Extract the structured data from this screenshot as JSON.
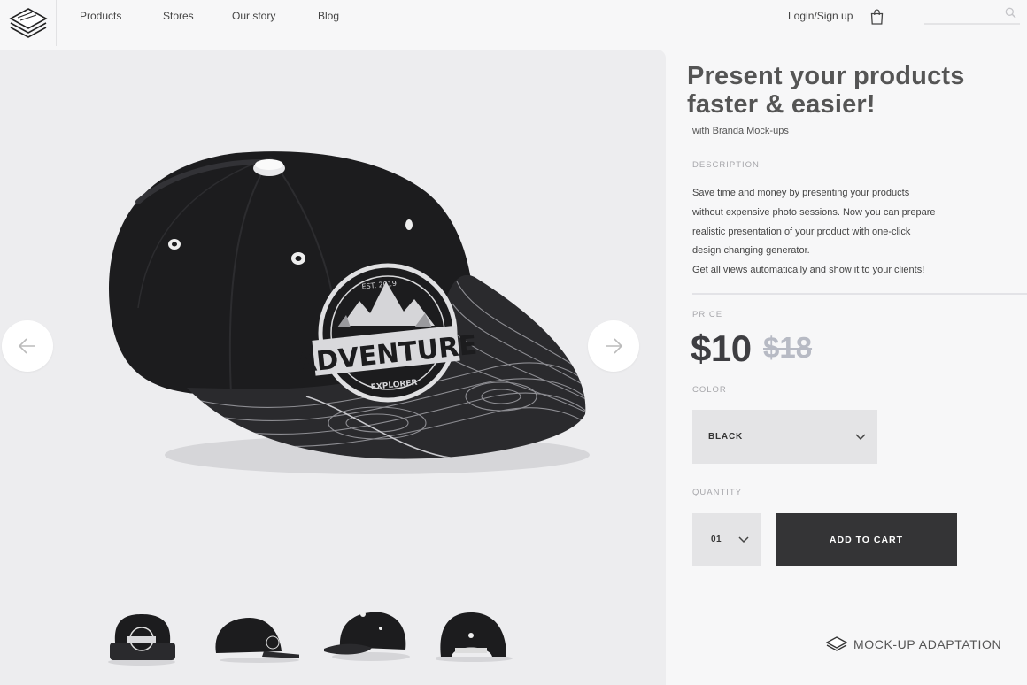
{
  "nav": {
    "items": [
      "Products",
      "Stores",
      "Our story",
      "Blog"
    ],
    "login_label": "Login/Sign up",
    "search_placeholder": ""
  },
  "gallery": {
    "hero_logo_line1": "ADVENTURE",
    "hero_logo_line2": "EXPLORER",
    "hero_logo_est": "EST. 2019"
  },
  "product": {
    "title_line1": "Present your products",
    "title_line2": "faster & easier!",
    "subtitle": "with Branda Mock-ups",
    "description_label": "DESCRIPTION",
    "description_lines": [
      "Save time and money by presenting your products",
      "without expensive photo sessions. Now you can prepare",
      "realistic presentation of your product with one-click",
      "design changing generator.",
      "Get all views automatically and show it to your clients!"
    ],
    "price_label": "PRICE",
    "price": "$10",
    "old_price": "$18",
    "color_label": "COLOR",
    "color_value": "BLACK",
    "quantity_label": "QUANTITY",
    "quantity_value": "01",
    "add_to_cart_label": "ADD TO CART"
  },
  "footer": {
    "brand_label": "MOCK-UP ADAPTATION"
  },
  "colors": {
    "background": "#f7f7f8",
    "stage": "#ededef",
    "button_dark": "#343436",
    "select_bg": "#e4e4e6",
    "old_price": "#b7bac4"
  }
}
